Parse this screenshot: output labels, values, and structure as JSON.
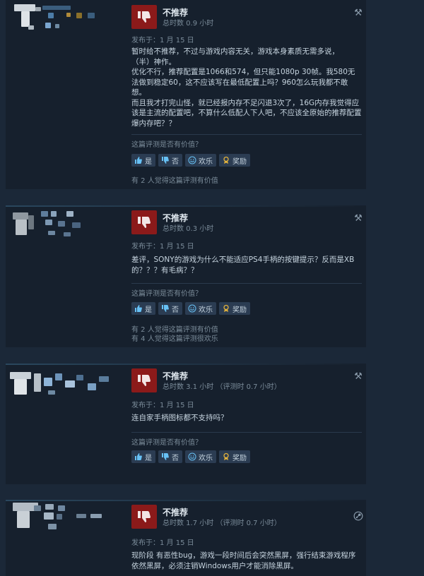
{
  "colors": {
    "background": "#1b2838",
    "card": "#16202d",
    "thumb_bg": "#8b1a1a",
    "button_bg": "#2b3c52",
    "award_icon": "#e3b33c"
  },
  "labels": {
    "not_recommended": "不推荐",
    "helpful_question": "这篇评测是否有价值？",
    "yes": "是",
    "no": "否",
    "funny": "欢乐",
    "award": "奖励"
  },
  "reviews": [
    {
      "hours": "总时数 0.9 小时",
      "posted": "发布于：1 月 15 日",
      "text": "暂时给不推荐，不过与游戏内容无关，游戏本身素质无需多说，\n（半）神作。\n优化不行，推荐配置是1066和574，但只能1080p 30帧。我580无法做到稳定60，这不应该写在最低配置上吗？960怎么玩我都不敢想。\n而且我才打完山怪，就已经报内存不足闪退3次了，16G内存我觉得应该是主流的配置吧，不算什么低配人下人吧，不应该全原始的推荐配置爆内存吧？？",
      "counts": [
        "有 2 人觉得这篇评测有价值"
      ],
      "corner_icon": "wrench-icon"
    },
    {
      "hours": "总时数 0.3 小时",
      "posted": "发布于：1 月 15 日",
      "text": "差评，SONY的游戏为什么不能适应PS4手柄的按键提示？反而是XB的？？？有毛病？？",
      "counts": [
        "有 2 人觉得这篇评测有价值",
        "有 4 人觉得这篇评测很欢乐"
      ],
      "corner_icon": "wrench-icon"
    },
    {
      "hours": "总时数 3.1 小时 （评测时 0.7 小时）",
      "posted": "发布于：1 月 15 日",
      "text": "连自家手柄图标都不支持吗？",
      "counts": [],
      "corner_icon": "wrench-icon"
    },
    {
      "hours": "总时数 1.7 小时 （评测时 0.7 小时）",
      "posted": "发布于：1 月 15 日",
      "text": "现阶段 有恶性bug，游戏一段时间后会突然黑屏，强行结束游戏程序依然黑屏，必须注销Windows用户才能消除黑屏。",
      "counts": [],
      "corner_icon": "steam-icon"
    }
  ]
}
